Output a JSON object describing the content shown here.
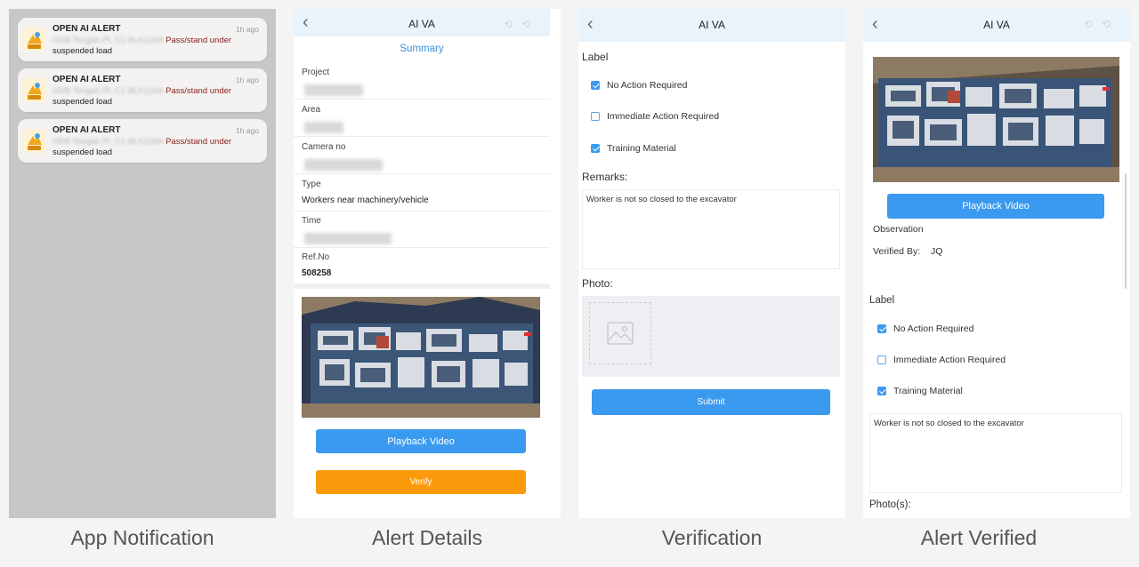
{
  "captions": {
    "notification": "App Notification",
    "details": "Alert Details",
    "verification": "Verification",
    "verified": "Alert Verified"
  },
  "notifications": [
    {
      "title": "OPEN AI ALERT",
      "time": "1h ago",
      "blurred": "HDB Tengah Pl, C1 BLK126A",
      "alert_text": "Pass/stand under",
      "line2": "suspended load"
    },
    {
      "title": "OPEN AI ALERT",
      "time": "1h ago",
      "blurred": "HDB Tengah Pl, C1 BLK126A",
      "alert_text": "Pass/stand under",
      "line2": "suspended load"
    },
    {
      "title": "OPEN AI ALERT",
      "time": "1h ago",
      "blurred": "HDB Tengah Pl, C1 BLK126A",
      "alert_text": "Pass/stand under",
      "line2": "suspended load"
    }
  ],
  "details": {
    "title": "AI VA",
    "summary": "Summary",
    "fields": {
      "project_label": "Project",
      "area_label": "Area",
      "camera_label": "Camera no",
      "type_label": "Type",
      "type_value": "Workers near machinery/vehicle",
      "time_label": "Time",
      "ref_label": "Ref.No",
      "ref_value": "508258"
    },
    "playback_label": "Playback Video",
    "verify_label": "Verify"
  },
  "verification": {
    "title": "AI VA",
    "label_heading": "Label",
    "options": [
      {
        "text": "No Action Required",
        "checked": true
      },
      {
        "text": "Immediate Action Required",
        "checked": false
      },
      {
        "text": "Training Material",
        "checked": true
      }
    ],
    "remarks_label": "Remarks:",
    "remarks_value": "Worker is not so closed to the excavator",
    "photo_label": "Photo:",
    "submit_label": "Submit"
  },
  "verified": {
    "title": "AI VA",
    "playback_label": "Playback Video",
    "observation_label": "Observation",
    "verified_by_label": "Verified By:",
    "verified_by_value": "JQ",
    "label_heading": "Label",
    "options": [
      {
        "text": "No Action Required",
        "checked": true
      },
      {
        "text": "Immediate Action Required",
        "checked": false
      },
      {
        "text": "Training Material",
        "checked": true
      }
    ],
    "remarks_value": "Worker is not so closed to the excavator",
    "photos_label": "Photo(s):"
  },
  "colors": {
    "accent_blue": "#3a9af0",
    "verify_orange": "#fb9b0b",
    "header_bg": "#e9f3fb",
    "alert_red": "#8a2020"
  }
}
